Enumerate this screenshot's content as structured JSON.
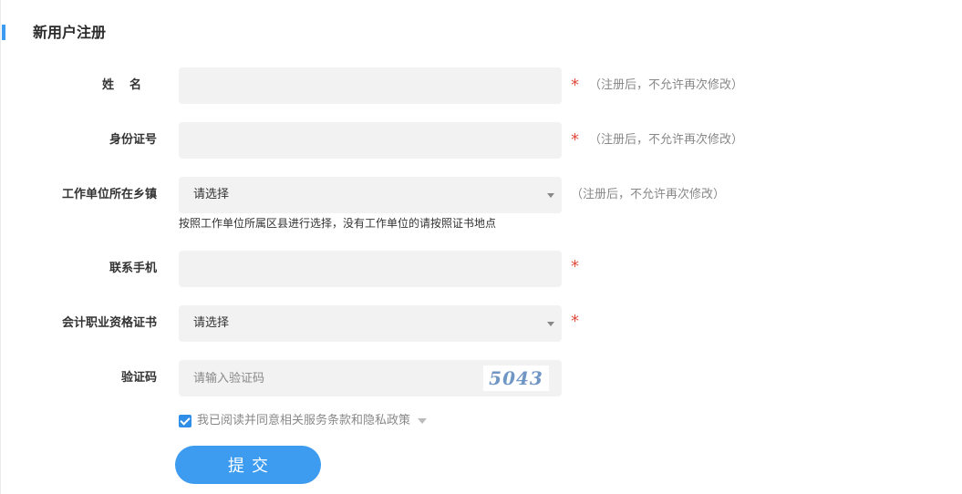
{
  "page": {
    "title": "新用户注册"
  },
  "colors": {
    "accent": "#3d9bf0",
    "required": "#e14b3b",
    "field_bg": "#f2f2f2",
    "hint": "#888888"
  },
  "form": {
    "name": {
      "label": "姓名",
      "value": "",
      "required_mark": "*",
      "hint": "（注册后，不允许再次修改）"
    },
    "id_number": {
      "label": "身份证号",
      "value": "",
      "required_mark": "*",
      "hint": "（注册后，不允许再次修改）"
    },
    "workplace_town": {
      "label": "工作单位所在乡镇",
      "selected": "请选择",
      "hint": "（注册后，不允许再次修改）",
      "sub_hint": "按照工作单位所属区县进行选择，没有工作单位的请按照证书地点"
    },
    "phone": {
      "label": "联系手机",
      "value": "",
      "required_mark": "*"
    },
    "certificate": {
      "label": "会计职业资格证书",
      "selected": "请选择",
      "required_mark": "*"
    },
    "captcha": {
      "label": "验证码",
      "placeholder": "请输入验证码",
      "image_text": "5043"
    },
    "agreement": {
      "checked": true,
      "text": "我已阅读并同意相关服务条款和隐私政策",
      "icon": "caret-down-icon"
    },
    "submit_label": "提交"
  }
}
